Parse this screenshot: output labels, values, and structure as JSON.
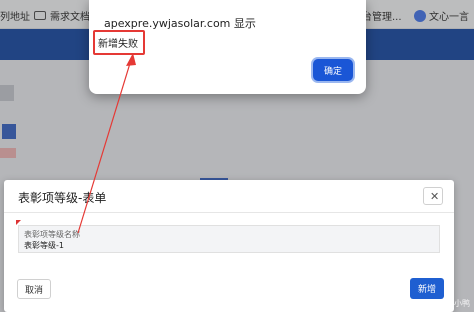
{
  "bookmarks": {
    "items": [
      {
        "label": "列地址",
        "icon": "none"
      },
      {
        "label": "需求文档",
        "icon": "folder-icon"
      },
      {
        "label": "台管理...",
        "icon": "folder-icon"
      },
      {
        "label": "文心一言",
        "icon": "wenxin-icon"
      }
    ]
  },
  "alert": {
    "host_line": "apexpre.ywjasolar.com 显示",
    "message": "新增失败",
    "ok_label": "确定"
  },
  "form_dialog": {
    "title": "表彰项等级-表单",
    "close_label": "✕",
    "field": {
      "label": "表彰项等级名称",
      "value": "表彰等级-1"
    },
    "cancel_label": "取消",
    "submit_label": "新增"
  },
  "watermark": "CSDN @王小小鸭",
  "colors": {
    "header_blue": "#1f4fa7",
    "primary_button": "#1f5fd1",
    "highlight_red": "#e53935"
  }
}
